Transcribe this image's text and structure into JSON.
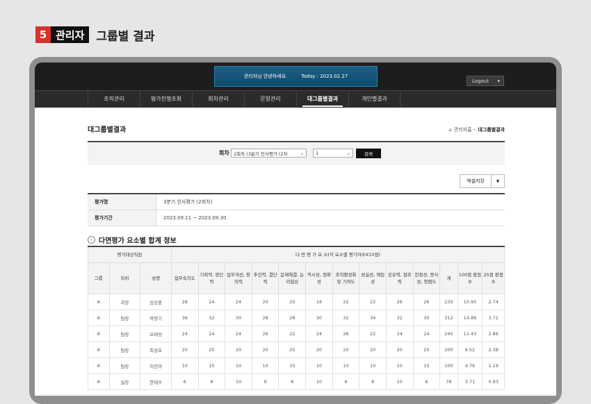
{
  "header": {
    "step_number": "5",
    "tag": "관리자",
    "title": "그룹별 결과"
  },
  "topbar": {
    "welcome": "관리자님 안녕하세요.",
    "today": "Today : 2023.02.27",
    "logout_label": "Logout"
  },
  "nav": {
    "items": [
      "조직관리",
      "평가진행조회",
      "회차관리",
      "문항관리",
      "대그룹별결과",
      "개인별결과"
    ],
    "active_index": 4
  },
  "page": {
    "title": "대그룹별결과",
    "breadcrumb_home": "관리자홈",
    "breadcrumb_current": "대그룹별결과"
  },
  "search": {
    "label": "회차",
    "round_value": "2회차 (3분기 인사평가 (2차",
    "option_value": "1",
    "button_label": "검색"
  },
  "actions": {
    "excel_label": "엑셀저장"
  },
  "info": [
    {
      "key": "평가명",
      "value": "3분기 인사평가 (2회차)"
    },
    {
      "key": "평가기간",
      "value": "2023.09.11 ~ 2023.09.30"
    }
  ],
  "section": {
    "title": "다면평가 요소별 합계 정보"
  },
  "table": {
    "group_header_left": "평가대상직원",
    "group_header_right": "다 면 평 가 요 소(각 요소별 평가자수X10점)",
    "columns": [
      "그룹",
      "직위",
      "성명",
      "업무숙지도",
      "기획력, 판단력",
      "업무개선, 창의력",
      "추진력, 결단력",
      "문제해결, 논리협상",
      "적시성, 정확성",
      "조직활성화 및 기여도",
      "성실성, 책임성",
      "공유력, 협조력",
      "친절성, 봉사성, 청렴도",
      "계",
      "100점 환점수",
      "25점 환점수"
    ],
    "rows": [
      [
        "A",
        "과장",
        "김상훈",
        "28",
        "24",
        "24",
        "20",
        "20",
        "18",
        "22",
        "22",
        "26",
        "26",
        "230",
        "10.95",
        "2.74"
      ],
      [
        "A",
        "팀장",
        "박영기",
        "36",
        "32",
        "30",
        "28",
        "28",
        "30",
        "32",
        "34",
        "32",
        "30",
        "312",
        "14.86",
        "3.71"
      ],
      [
        "A",
        "팀장",
        "오태성",
        "24",
        "24",
        "24",
        "26",
        "22",
        "24",
        "26",
        "22",
        "24",
        "24",
        "240",
        "11.43",
        "2.86"
      ],
      [
        "A",
        "팀장",
        "최성호",
        "20",
        "20",
        "20",
        "20",
        "20",
        "20",
        "20",
        "20",
        "20",
        "20",
        "200",
        "9.52",
        "2.38"
      ],
      [
        "A",
        "팀장",
        "이진아",
        "10",
        "10",
        "10",
        "10",
        "10",
        "10",
        "10",
        "10",
        "10",
        "10",
        "100",
        "4.76",
        "1.19"
      ],
      [
        "A",
        "실장",
        "한태수",
        "6",
        "8",
        "10",
        "6",
        "8",
        "10",
        "6",
        "8",
        "10",
        "6",
        "78",
        "3.71",
        "0.93"
      ]
    ]
  },
  "colors": {
    "accent_red": "#d9322b",
    "topbar": "#1d1d1d",
    "welcome_panel": "#0f4a6c"
  }
}
